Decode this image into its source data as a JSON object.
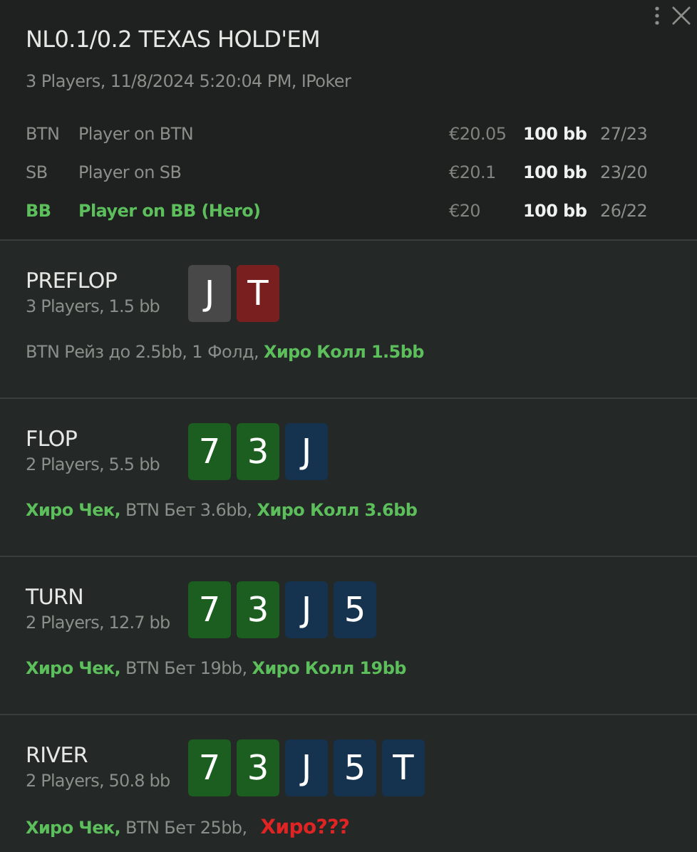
{
  "header": {
    "title": "NL0.1/0.2 TEXAS HOLD'EM",
    "subtitle": "3 Players, 11/8/2024 5:20:04 PM, IPoker",
    "players": [
      {
        "position": "BTN",
        "name": "Player on BTN",
        "stack": "€20.05",
        "bb": "100 bb",
        "stats": "27/23",
        "hero": false
      },
      {
        "position": "SB",
        "name": "Player on SB",
        "stack": "€20.1",
        "bb": "100 bb",
        "stats": "23/20",
        "hero": false
      },
      {
        "position": "BB",
        "name": "Player on BB (Hero)",
        "stack": "€20",
        "bb": "100 bb",
        "stats": "26/22",
        "hero": true
      }
    ]
  },
  "streets": [
    {
      "name": "PREFLOP",
      "info": "3 Players, 1.5 bb",
      "cards": [
        {
          "rank": "J",
          "color": "#484848"
        },
        {
          "rank": "T",
          "color": "#7a1f1f"
        }
      ],
      "actions": [
        {
          "text": "BTN Рейз до 2.5bb, 1 Фолд,",
          "kind": "other"
        },
        {
          "text": "Хиро Колл 1.5bb",
          "kind": "hero"
        }
      ]
    },
    {
      "name": "FLOP",
      "info": "2 Players, 5.5 bb",
      "cards": [
        {
          "rank": "7",
          "color": "#1b5e20"
        },
        {
          "rank": "3",
          "color": "#1b5e20"
        },
        {
          "rank": "J",
          "color": "#15324f"
        }
      ],
      "actions": [
        {
          "text": "Хиро Чек,",
          "kind": "hero"
        },
        {
          "text": "BTN Бет 3.6bb,",
          "kind": "other"
        },
        {
          "text": "Хиро Колл 3.6bb",
          "kind": "hero"
        }
      ]
    },
    {
      "name": "TURN",
      "info": "2 Players, 12.7 bb",
      "cards": [
        {
          "rank": "7",
          "color": "#1b5e20"
        },
        {
          "rank": "3",
          "color": "#1b5e20"
        },
        {
          "rank": "J",
          "color": "#15324f"
        },
        {
          "rank": "5",
          "color": "#15324f"
        }
      ],
      "actions": [
        {
          "text": "Хиро Чек,",
          "kind": "hero"
        },
        {
          "text": "BTN Бет 19bb,",
          "kind": "other"
        },
        {
          "text": "Хиро Колл 19bb",
          "kind": "hero"
        }
      ]
    },
    {
      "name": "RIVER",
      "info": "2 Players, 50.8 bb",
      "cards": [
        {
          "rank": "7",
          "color": "#1b5e20"
        },
        {
          "rank": "3",
          "color": "#1b5e20"
        },
        {
          "rank": "J",
          "color": "#15324f"
        },
        {
          "rank": "5",
          "color": "#15324f"
        },
        {
          "rank": "T",
          "color": "#15324f"
        }
      ],
      "actions": [
        {
          "text": "Хиро Чек,",
          "kind": "hero"
        },
        {
          "text": "BTN Бет 25bb,",
          "kind": "other"
        },
        {
          "text": "Хиро???",
          "kind": "unknown"
        }
      ]
    }
  ]
}
